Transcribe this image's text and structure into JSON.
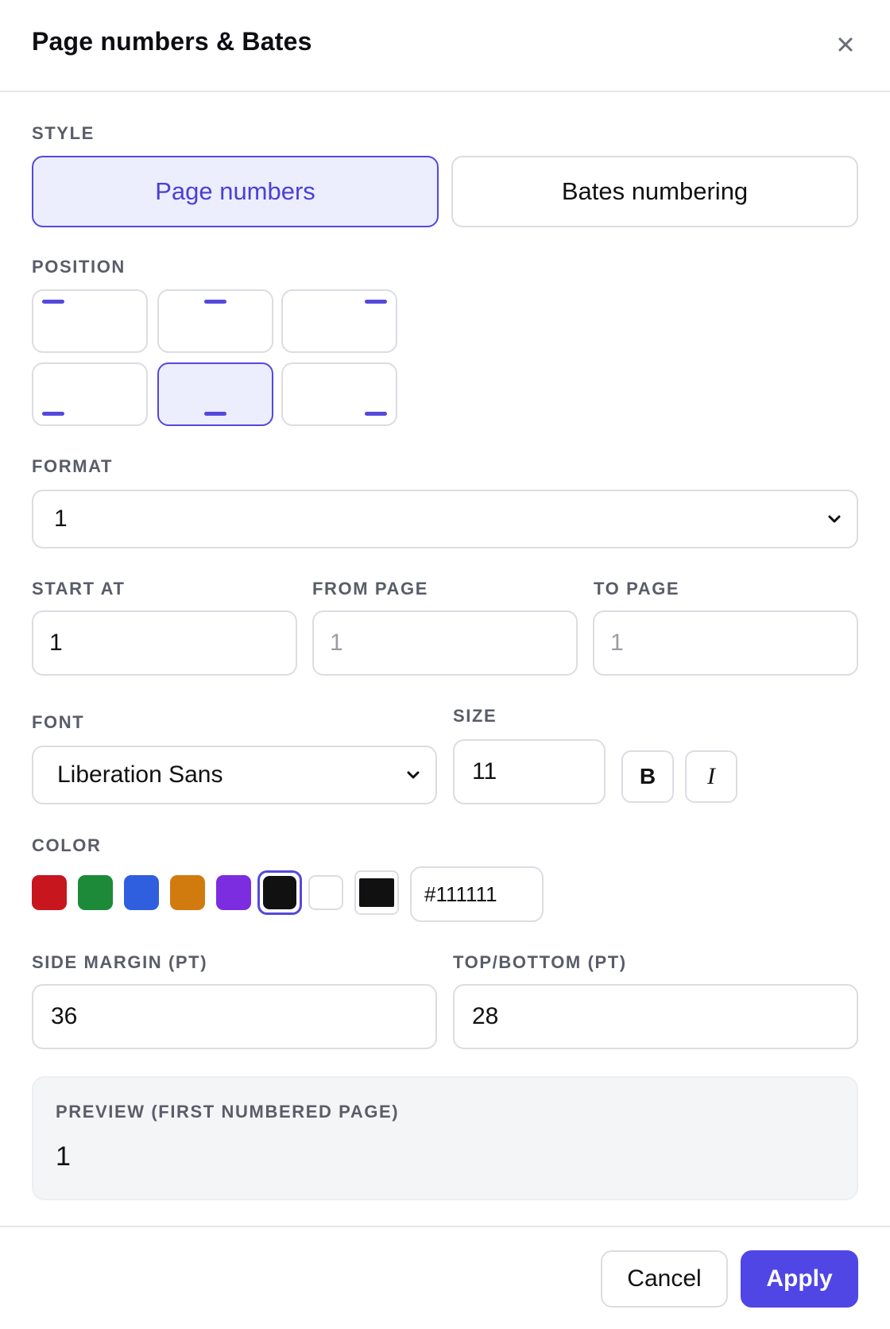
{
  "dialog": {
    "title": "Page numbers & Bates",
    "close_icon": "close-icon"
  },
  "style": {
    "label": "STYLE",
    "options": [
      "Page numbers",
      "Bates numbering"
    ],
    "selected": "Page numbers"
  },
  "position": {
    "label": "POSITION",
    "cells": [
      "top-left",
      "top-center",
      "top-right",
      "bottom-left",
      "bottom-center",
      "bottom-right"
    ],
    "selected": "bottom-center"
  },
  "format": {
    "label": "FORMAT",
    "value": "1"
  },
  "start_at": {
    "label": "START AT",
    "value": "1"
  },
  "from_page": {
    "label": "FROM PAGE",
    "placeholder": "1"
  },
  "to_page": {
    "label": "TO PAGE",
    "placeholder": "1"
  },
  "font": {
    "label": "FONT",
    "value": "Liberation Sans"
  },
  "size": {
    "label": "SIZE",
    "value": "11",
    "bold_label": "B",
    "italic_label": "I"
  },
  "color": {
    "label": "COLOR",
    "swatches": [
      "#c8161e",
      "#1d8a3a",
      "#2f5fde",
      "#d17b0f",
      "#7c2de0",
      "#111111",
      "#ffffff"
    ],
    "selected": "#111111",
    "picker_color": "#111111",
    "hex_value": "#111111"
  },
  "side_margin": {
    "label": "SIDE MARGIN (PT)",
    "value": "36"
  },
  "top_bottom": {
    "label": "TOP/BOTTOM (PT)",
    "value": "28"
  },
  "preview": {
    "label": "PREVIEW (FIRST NUMBERED PAGE)",
    "value": "1"
  },
  "footer": {
    "cancel_label": "Cancel",
    "apply_label": "Apply"
  },
  "theme": {
    "accent": "#4f46e5",
    "accent_light": "#eceefd"
  }
}
